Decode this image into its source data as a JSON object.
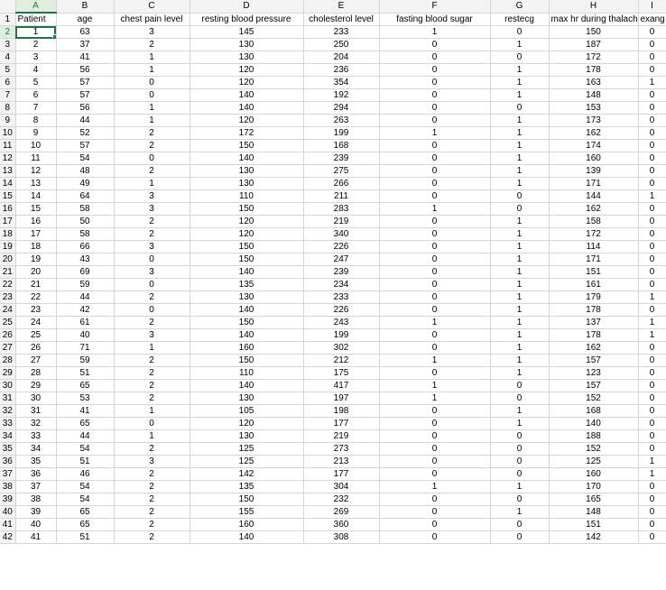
{
  "columns": [
    "A",
    "B",
    "C",
    "D",
    "E",
    "F",
    "G",
    "H",
    "I"
  ],
  "headers": [
    "Patient",
    "age",
    "chest pain level",
    "resting blood pressure",
    "cholesterol level",
    "fasting blood sugar",
    "restecg",
    "max hr during thalach",
    "exang"
  ],
  "rows": [
    [
      1,
      63,
      3,
      145,
      233,
      1,
      0,
      150,
      0
    ],
    [
      2,
      37,
      2,
      130,
      250,
      0,
      1,
      187,
      0
    ],
    [
      3,
      41,
      1,
      130,
      204,
      0,
      0,
      172,
      0
    ],
    [
      4,
      56,
      1,
      120,
      236,
      0,
      1,
      178,
      0
    ],
    [
      5,
      57,
      0,
      120,
      354,
      0,
      1,
      163,
      1
    ],
    [
      6,
      57,
      0,
      140,
      192,
      0,
      1,
      148,
      0
    ],
    [
      7,
      56,
      1,
      140,
      294,
      0,
      0,
      153,
      0
    ],
    [
      8,
      44,
      1,
      120,
      263,
      0,
      1,
      173,
      0
    ],
    [
      9,
      52,
      2,
      172,
      199,
      1,
      1,
      162,
      0
    ],
    [
      10,
      57,
      2,
      150,
      168,
      0,
      1,
      174,
      0
    ],
    [
      11,
      54,
      0,
      140,
      239,
      0,
      1,
      160,
      0
    ],
    [
      12,
      48,
      2,
      130,
      275,
      0,
      1,
      139,
      0
    ],
    [
      13,
      49,
      1,
      130,
      266,
      0,
      1,
      171,
      0
    ],
    [
      14,
      64,
      3,
      110,
      211,
      0,
      0,
      144,
      1
    ],
    [
      15,
      58,
      3,
      150,
      283,
      1,
      0,
      162,
      0
    ],
    [
      16,
      50,
      2,
      120,
      219,
      0,
      1,
      158,
      0
    ],
    [
      17,
      58,
      2,
      120,
      340,
      0,
      1,
      172,
      0
    ],
    [
      18,
      66,
      3,
      150,
      226,
      0,
      1,
      114,
      0
    ],
    [
      19,
      43,
      0,
      150,
      247,
      0,
      1,
      171,
      0
    ],
    [
      20,
      69,
      3,
      140,
      239,
      0,
      1,
      151,
      0
    ],
    [
      21,
      59,
      0,
      135,
      234,
      0,
      1,
      161,
      0
    ],
    [
      22,
      44,
      2,
      130,
      233,
      0,
      1,
      179,
      1
    ],
    [
      23,
      42,
      0,
      140,
      226,
      0,
      1,
      178,
      0
    ],
    [
      24,
      61,
      2,
      150,
      243,
      1,
      1,
      137,
      1
    ],
    [
      25,
      40,
      3,
      140,
      199,
      0,
      1,
      178,
      1
    ],
    [
      26,
      71,
      1,
      160,
      302,
      0,
      1,
      162,
      0
    ],
    [
      27,
      59,
      2,
      150,
      212,
      1,
      1,
      157,
      0
    ],
    [
      28,
      51,
      2,
      110,
      175,
      0,
      1,
      123,
      0
    ],
    [
      29,
      65,
      2,
      140,
      417,
      1,
      0,
      157,
      0
    ],
    [
      30,
      53,
      2,
      130,
      197,
      1,
      0,
      152,
      0
    ],
    [
      31,
      41,
      1,
      105,
      198,
      0,
      1,
      168,
      0
    ],
    [
      32,
      65,
      0,
      120,
      177,
      0,
      1,
      140,
      0
    ],
    [
      33,
      44,
      1,
      130,
      219,
      0,
      0,
      188,
      0
    ],
    [
      34,
      54,
      2,
      125,
      273,
      0,
      0,
      152,
      0
    ],
    [
      35,
      51,
      3,
      125,
      213,
      0,
      0,
      125,
      1
    ],
    [
      36,
      46,
      2,
      142,
      177,
      0,
      0,
      160,
      1
    ],
    [
      37,
      54,
      2,
      135,
      304,
      1,
      1,
      170,
      0
    ],
    [
      38,
      54,
      2,
      150,
      232,
      0,
      0,
      165,
      0
    ],
    [
      39,
      65,
      2,
      155,
      269,
      0,
      1,
      148,
      0
    ],
    [
      40,
      65,
      2,
      160,
      360,
      0,
      0,
      151,
      0
    ],
    [
      41,
      51,
      2,
      140,
      308,
      0,
      0,
      142,
      0
    ]
  ]
}
